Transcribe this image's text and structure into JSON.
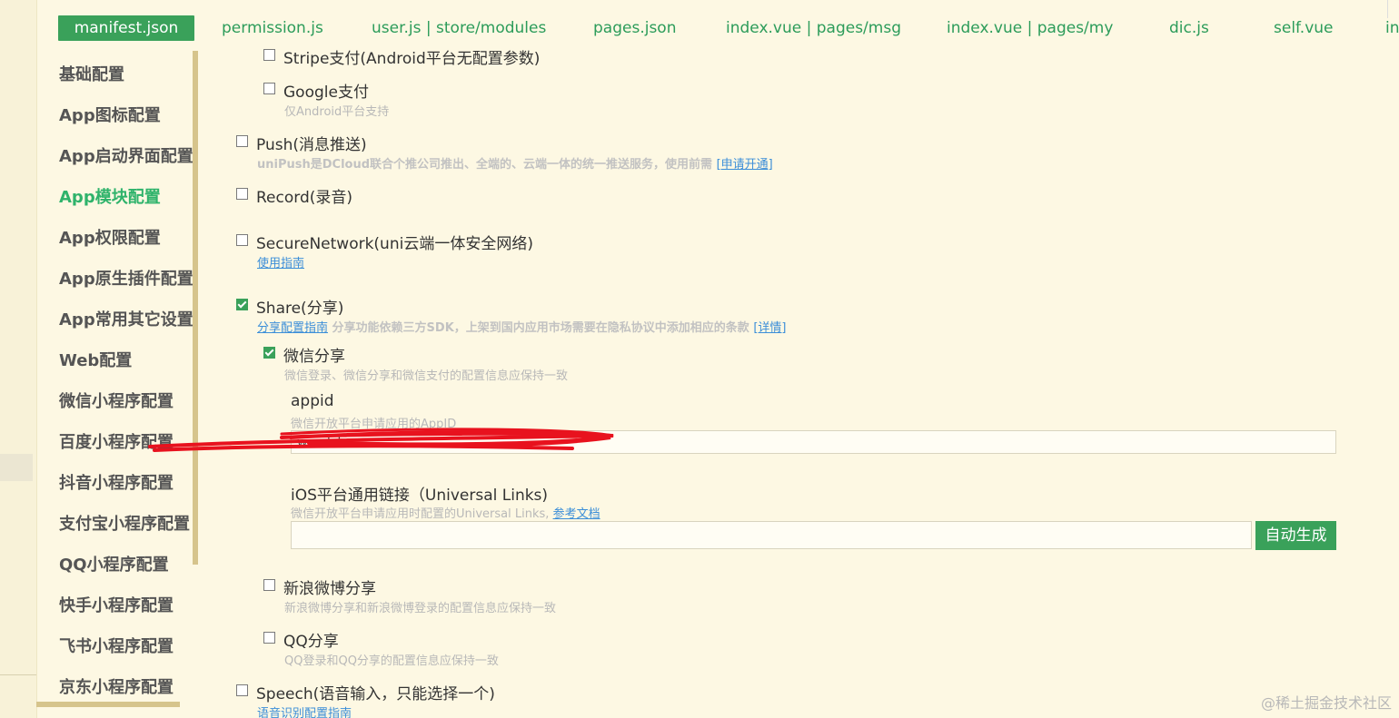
{
  "tabs": [
    {
      "label": "manifest.json",
      "active": true
    },
    {
      "label": "permission.js"
    },
    {
      "label": "user.js | store/modules"
    },
    {
      "label": "pages.json"
    },
    {
      "label": "index.vue | pages/msg"
    },
    {
      "label": "index.vue | pages/my"
    },
    {
      "label": "dic.js"
    },
    {
      "label": "self.vue"
    },
    {
      "label": "in"
    }
  ],
  "sidebar": {
    "items": [
      {
        "label": "基础配置"
      },
      {
        "label": "App图标配置"
      },
      {
        "label": "App启动界面配置"
      },
      {
        "label": "App模块配置",
        "active": true
      },
      {
        "label": "App权限配置"
      },
      {
        "label": "App原生插件配置"
      },
      {
        "label": "App常用其它设置"
      },
      {
        "label": "Web配置"
      },
      {
        "label": "微信小程序配置"
      },
      {
        "label": "百度小程序配置"
      },
      {
        "label": "抖音小程序配置"
      },
      {
        "label": "支付宝小程序配置"
      },
      {
        "label": "QQ小程序配置"
      },
      {
        "label": "快手小程序配置"
      },
      {
        "label": "飞书小程序配置"
      },
      {
        "label": "京东小程序配置"
      }
    ]
  },
  "modules": {
    "stripe": {
      "label": "Stripe支付(Android平台无配置参数)",
      "checked": false
    },
    "google": {
      "label": "Google支付",
      "desc": "仅Android平台支持",
      "checked": false
    },
    "push": {
      "label": "Push(消息推送)",
      "desc": "uniPush是DCloud联合个推公司推出、全端的、云端一体的统一推送服务，使用前需",
      "link": "[申请开通]",
      "checked": false
    },
    "record": {
      "label": "Record(录音)",
      "checked": false
    },
    "secure": {
      "label": "SecureNetwork(uni云端一体安全网络)",
      "link": "使用指南",
      "checked": false
    },
    "share": {
      "label": "Share(分享)",
      "checked": true,
      "link1": "分享配置指南",
      "desc": "分享功能依赖三方SDK，上架到国内应用市场需要在隐私协议中添加相应的条款",
      "link2": "[详情]",
      "wechat": {
        "label": "微信分享",
        "checked": true,
        "desc": "微信登录、微信分享和微信支付的配置信息应保持一致",
        "appid_label": "appid",
        "appid_desc": "微信开放平台申请应用的AppID",
        "appid_value": "wxedcbe...",
        "ul_label": "iOS平台通用链接（Universal Links)",
        "ul_desc": "微信开放平台申请应用时配置的Universal Links,",
        "ul_link": "参考文档",
        "ul_value": "",
        "auto_button": "自动生成"
      },
      "weibo": {
        "label": "新浪微博分享",
        "desc": "新浪微博分享和新浪微博登录的配置信息应保持一致",
        "checked": false
      },
      "qq": {
        "label": "QQ分享",
        "desc": "QQ登录和QQ分享的配置信息应保持一致",
        "checked": false
      }
    },
    "speech": {
      "label": "Speech(语音输入，只能选择一个)",
      "link": "语音识别配置指南",
      "checked": false
    }
  },
  "watermark": "@稀土掘金技术社区",
  "colors": {
    "accent": "#3aa15a",
    "background": "#fdf8e3",
    "link": "#3b8ed8",
    "redaction": "#e8121e"
  }
}
